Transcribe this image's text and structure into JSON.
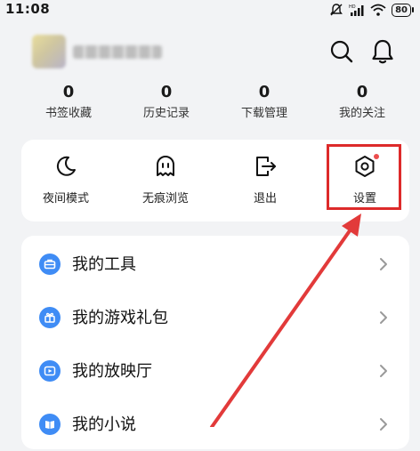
{
  "status": {
    "time": "11:08",
    "battery": "80"
  },
  "stats": [
    {
      "count": "0",
      "label": "书签收藏"
    },
    {
      "count": "0",
      "label": "历史记录"
    },
    {
      "count": "0",
      "label": "下载管理"
    },
    {
      "count": "0",
      "label": "我的关注"
    }
  ],
  "quick_actions": [
    {
      "label": "夜间模式",
      "icon": "moon-icon"
    },
    {
      "label": "无痕浏览",
      "icon": "ghost-icon"
    },
    {
      "label": "退出",
      "icon": "exit-icon"
    },
    {
      "label": "设置",
      "icon": "settings-icon"
    }
  ],
  "menu": [
    {
      "label": "我的工具",
      "icon": "toolbox-icon"
    },
    {
      "label": "我的游戏礼包",
      "icon": "game-gift-icon"
    },
    {
      "label": "我的放映厅",
      "icon": "play-icon"
    },
    {
      "label": "我的小说",
      "icon": "book-icon"
    }
  ],
  "colors": {
    "accent": "#3f8cf5",
    "highlight": "#dd2a2a",
    "badge": "#ec4d4d",
    "background": "#f2f3f5"
  }
}
